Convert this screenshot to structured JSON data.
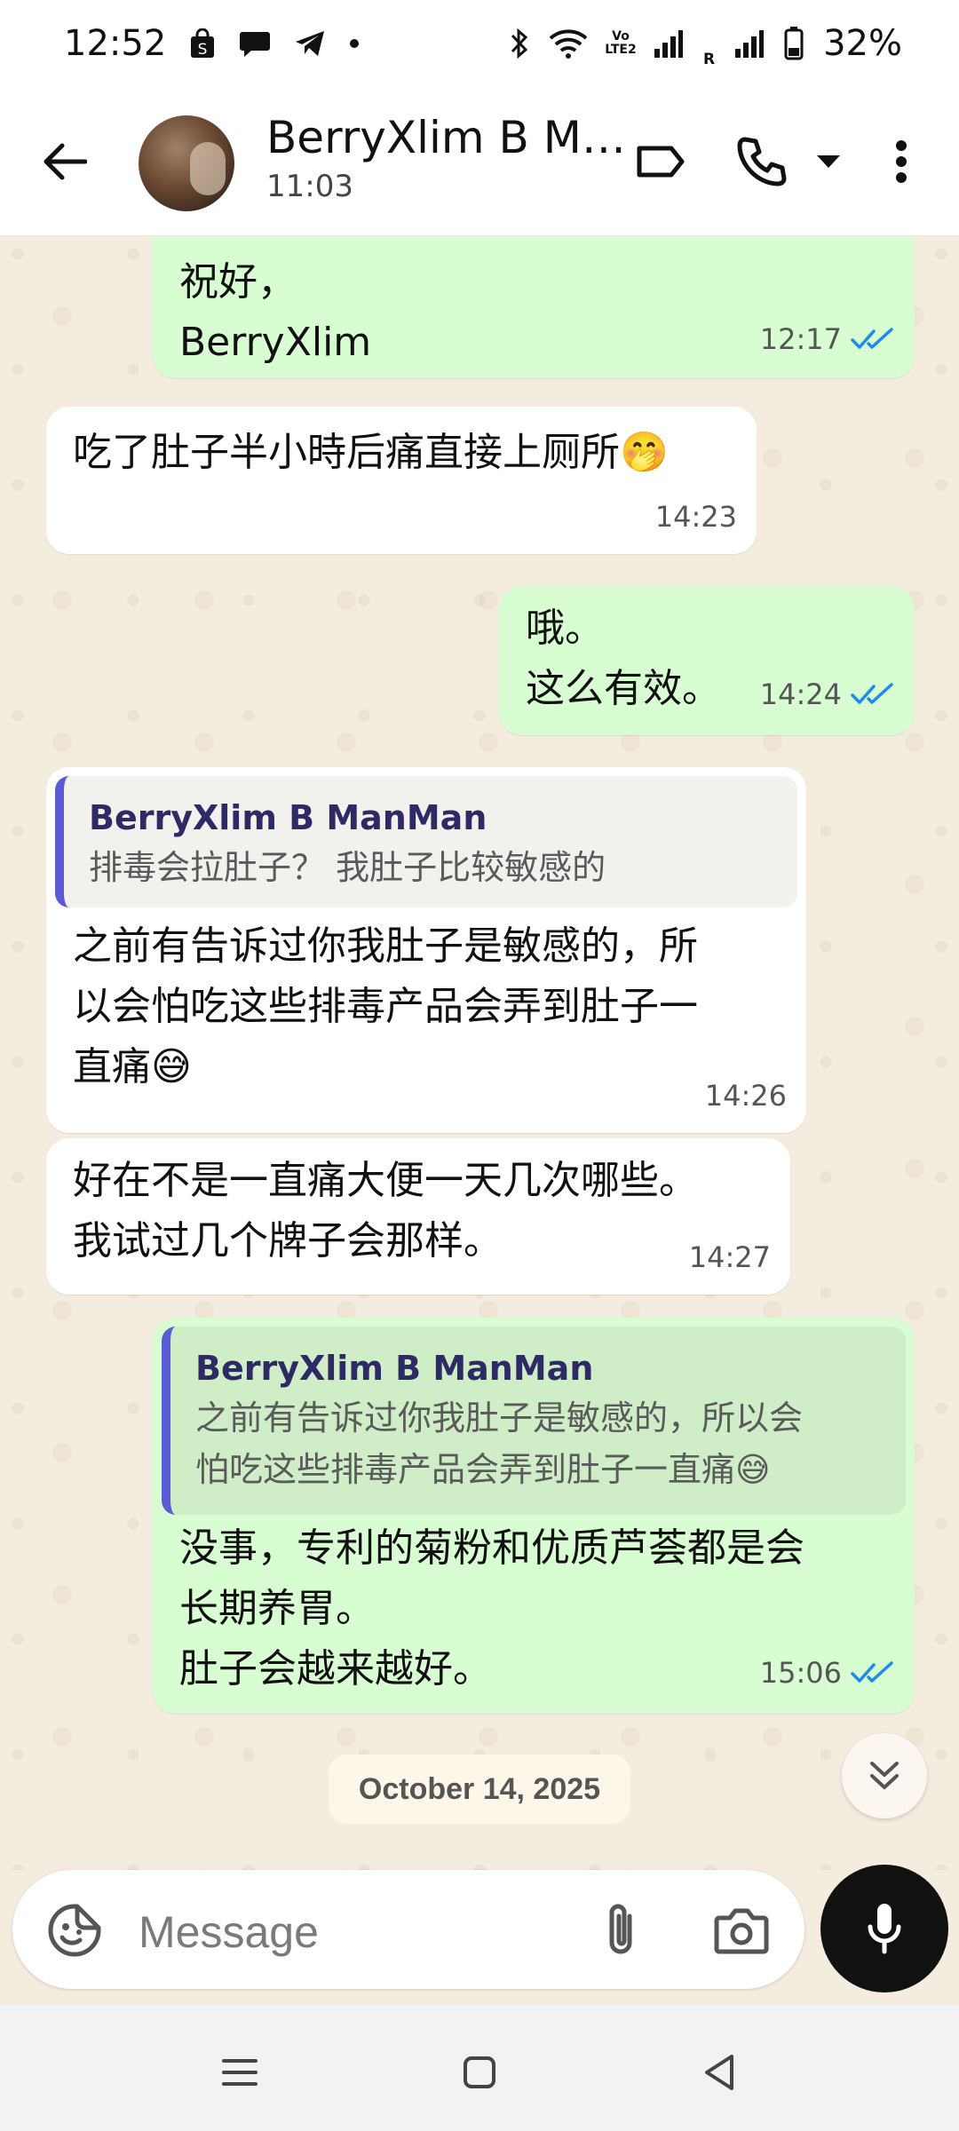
{
  "status_bar": {
    "time": "12:52",
    "battery": "32%",
    "volte_label": "Vo LTE2",
    "roaming_label": "R",
    "icons": [
      "shopping-bag-icon",
      "chat-bubble-icon",
      "telegram-icon",
      "dot-icon",
      "bluetooth-icon",
      "wifi-icon",
      "signal-icon",
      "battery-icon"
    ]
  },
  "header": {
    "title": "BerryXlim B M…",
    "subtitle": "11:03",
    "icons": [
      "back-arrow-icon",
      "label-icon",
      "phone-icon",
      "dropdown-icon",
      "more-icon"
    ]
  },
  "messages": [
    {
      "direction": "out",
      "lines": [
        "祝好，",
        "BerryXlim"
      ],
      "time": "12:17",
      "read": true
    },
    {
      "direction": "in",
      "lines": [
        "吃了肚子半小時后痛直接上厕所🤭"
      ],
      "time": "14:23"
    },
    {
      "direction": "out",
      "lines": [
        "哦。",
        "这么有效。"
      ],
      "time": "14:24",
      "read": true
    },
    {
      "direction": "in",
      "quote": {
        "author": "BerryXlim B ManMan",
        "text": "排毒会拉肚子？ 我肚子比较敏感的"
      },
      "lines": [
        "之前有告诉过你我肚子是敏感的，所",
        "以会怕吃这些排毒产品会弄到肚子一",
        "直痛😅"
      ],
      "time": "14:26"
    },
    {
      "direction": "in",
      "lines": [
        "好在不是一直痛大便一天几次哪些。",
        "我试过几个牌子会那样。"
      ],
      "time": "14:27"
    },
    {
      "direction": "out",
      "quote": {
        "author": "BerryXlim B ManMan",
        "lines": [
          "之前有告诉过你我肚子是敏感的，所以会",
          "怕吃这些排毒产品会弄到肚子一直痛😅"
        ]
      },
      "lines": [
        "没事，专利的菊粉和优质芦荟都是会",
        "长期养胃。",
        "肚子会越来越好。"
      ],
      "time": "15:06",
      "read": true
    }
  ],
  "date_chip": "October 14, 2025",
  "composer": {
    "placeholder": "Message",
    "icons": [
      "sticker-icon",
      "attach-icon",
      "camera-icon",
      "mic-icon"
    ]
  },
  "colors": {
    "outgoing_bubble": "#d9fdd3",
    "incoming_bubble": "#ffffff",
    "read_ticks": "#1a8cf0",
    "quote_bar": "#5b5bd6",
    "chat_background": "#f3ecdf"
  },
  "navbar": {
    "icons": [
      "recents-icon",
      "home-icon",
      "back-icon"
    ]
  }
}
